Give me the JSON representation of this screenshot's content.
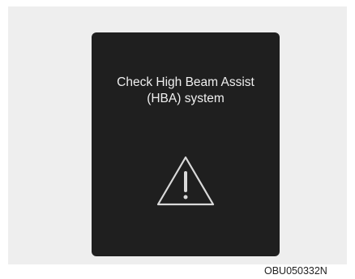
{
  "display": {
    "message": "Check High Beam Assist\n(HBA) system",
    "icon": "warning-triangle-icon"
  },
  "figure_code": "OBU050332N",
  "colors": {
    "display_background": "#1f1f1f",
    "display_text": "#efefef",
    "frame_background": "#eeeeee"
  }
}
